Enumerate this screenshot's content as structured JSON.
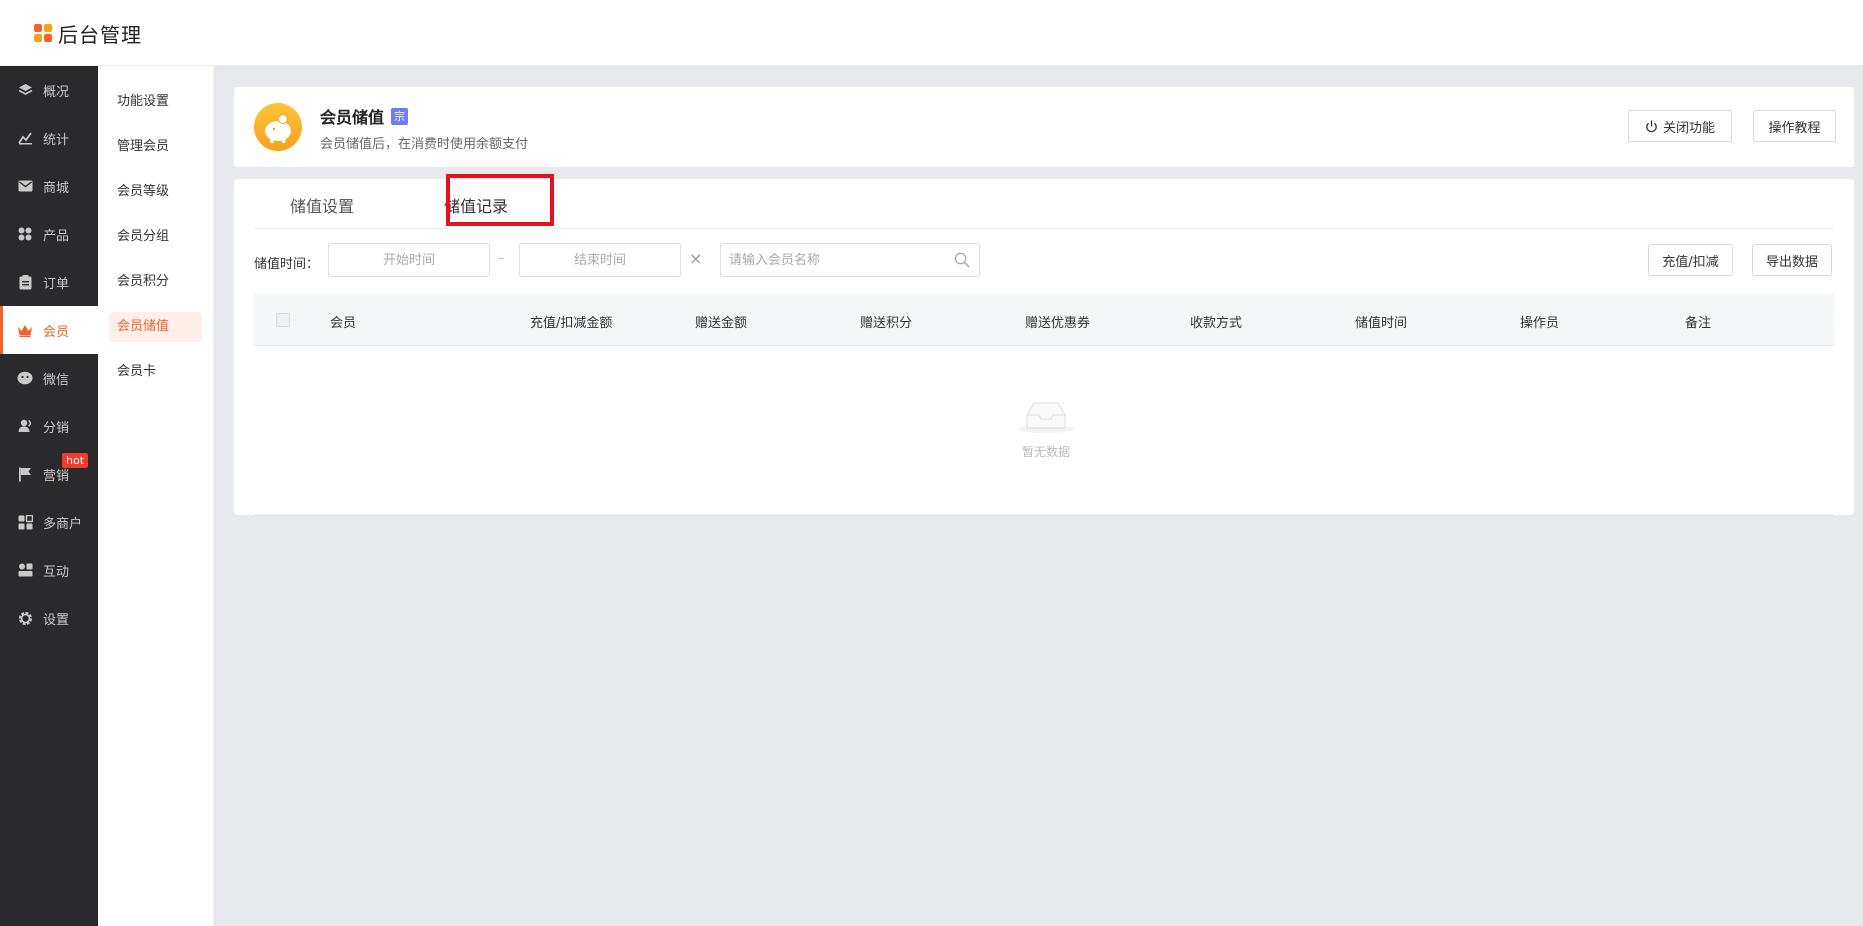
{
  "app": {
    "title": "后台管理"
  },
  "nav": {
    "items": [
      {
        "label": "概况",
        "icon": "layers-icon"
      },
      {
        "label": "统计",
        "icon": "chart-icon"
      },
      {
        "label": "商城",
        "icon": "mail-icon"
      },
      {
        "label": "产品",
        "icon": "grid-icon"
      },
      {
        "label": "订单",
        "icon": "clipboard-icon"
      },
      {
        "label": "会员",
        "icon": "crown-icon",
        "active": true
      },
      {
        "label": "微信",
        "icon": "wechat-icon"
      },
      {
        "label": "分销",
        "icon": "users-icon"
      },
      {
        "label": "营销",
        "icon": "flag-icon",
        "badge": "hot"
      },
      {
        "label": "多商户",
        "icon": "store-icon"
      },
      {
        "label": "互动",
        "icon": "interact-icon"
      },
      {
        "label": "设置",
        "icon": "gear-icon"
      }
    ]
  },
  "subnav": {
    "items": [
      "功能设置",
      "管理会员",
      "会员等级",
      "会员分组",
      "会员积分",
      "会员储值",
      "会员卡"
    ],
    "active": "会员储值"
  },
  "header": {
    "title": "会员储值",
    "tag": "宗",
    "description": "会员储值后，在消费时使用余额支付",
    "close_button": "关闭功能",
    "tutorial_button": "操作教程",
    "icon": "piggy-bank-icon"
  },
  "tabs": [
    {
      "label": "储值设置",
      "active": false
    },
    {
      "label": "储值记录",
      "active": true
    }
  ],
  "filter": {
    "label": "储值时间：",
    "start_placeholder": "开始时间",
    "end_placeholder": "结束时间",
    "separator": "–",
    "clear": "×",
    "search_placeholder": "请输入会员名称",
    "recharge_button": "充值/扣减",
    "export_button": "导出数据"
  },
  "table": {
    "columns": [
      "会员",
      "充值/扣减金额",
      "赠送金额",
      "赠送积分",
      "赠送优惠券",
      "收款方式",
      "储值时间",
      "操作员",
      "备注"
    ],
    "rows": [],
    "empty_text": "暂无数据"
  },
  "colors": {
    "accent": "#f0642c",
    "sidebar": "#2a2a2c",
    "highlight": "#e8101f",
    "badge": "#f33a2e"
  }
}
